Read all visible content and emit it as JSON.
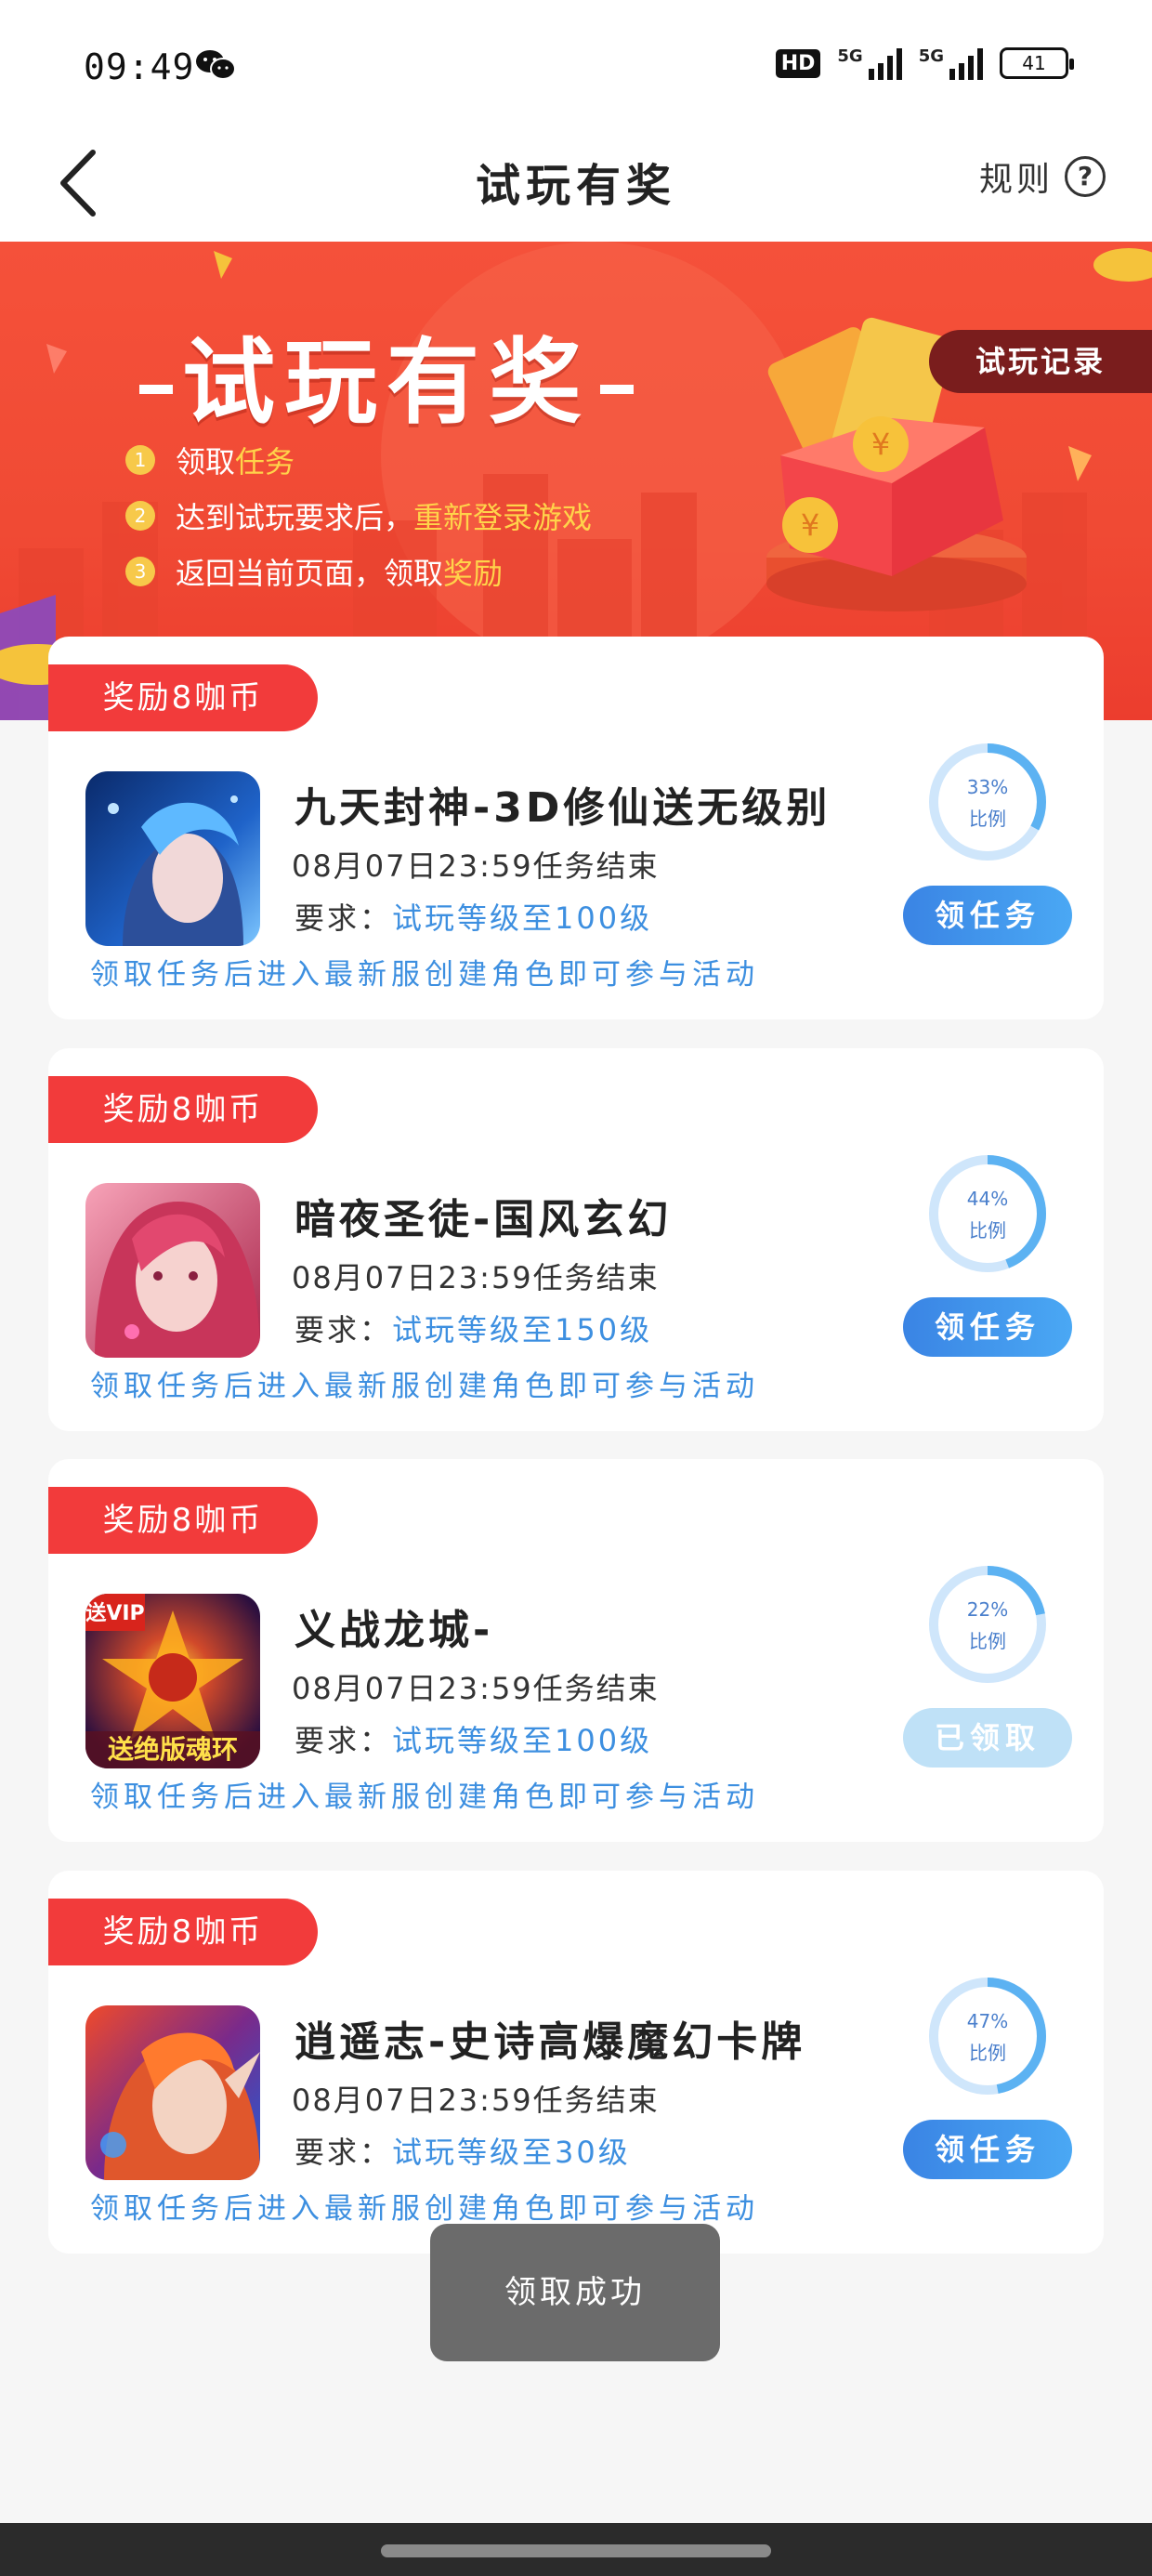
{
  "status_bar": {
    "time": "09:49",
    "hd_label": "HD",
    "signal1_label": "5G",
    "signal2_label": "5G",
    "battery": "41"
  },
  "nav": {
    "title": "试玩有奖",
    "rules_label": "规则"
  },
  "banner": {
    "title": "试玩有奖",
    "record_button": "试玩记录",
    "steps": [
      {
        "num": "1",
        "text": "领取",
        "highlight": "任务"
      },
      {
        "num": "2",
        "text": "达到试玩要求后，",
        "highlight": "重新登录游戏"
      },
      {
        "num": "3",
        "text": "返回当前页面，领取",
        "highlight": "奖励"
      }
    ]
  },
  "tasks": [
    {
      "reward": "奖励8咖币",
      "name": "九天封神-3D修仙送无级别",
      "deadline": "08月07日23:59任务结束",
      "req_label": "要求：",
      "req_value": "试玩等级至100级",
      "note": "领取任务后进入最新服创建角色即可参与活动",
      "percent": "33%",
      "percent_value": 33,
      "percent_label": "比例",
      "button": "领任务",
      "claimed": false
    },
    {
      "reward": "奖励8咖币",
      "name": "暗夜圣徒-国风玄幻",
      "deadline": "08月07日23:59任务结束",
      "req_label": "要求：",
      "req_value": "试玩等级至150级",
      "note": "领取任务后进入最新服创建角色即可参与活动",
      "percent": "44%",
      "percent_value": 44,
      "percent_label": "比例",
      "button": "领任务",
      "claimed": false
    },
    {
      "reward": "奖励8咖币",
      "name": "义战龙城-",
      "deadline": "08月07日23:59任务结束",
      "req_label": "要求：",
      "req_value": "试玩等级至100级",
      "note": "领取任务后进入最新服创建角色即可参与活动",
      "percent": "22%",
      "percent_value": 22,
      "percent_label": "比例",
      "button": "已领取",
      "claimed": true,
      "icon_badge": "送VIP",
      "icon_caption": "送绝版魂环"
    },
    {
      "reward": "奖励8咖币",
      "name": "逍遥志-史诗高爆魔幻卡牌",
      "deadline": "08月07日23:59任务结束",
      "req_label": "要求：",
      "req_value": "试玩等级至30级",
      "note": "领取任务后进入最新服创建角色即可参与活动",
      "percent": "47%",
      "percent_value": 47,
      "percent_label": "比例",
      "button": "领任务",
      "claimed": false
    }
  ],
  "toast": "领取成功",
  "colors": {
    "banner_red": "#f04a34",
    "reward_red": "#f23b3b",
    "blue_text": "#3d8fe0",
    "button_blue": "#3a84e4",
    "claimed_blue": "#bfe1f7",
    "highlight_yellow": "#ffd34a"
  },
  "icons": [
    "wechat-icon",
    "back-arrow-icon",
    "help-circle-icon"
  ]
}
